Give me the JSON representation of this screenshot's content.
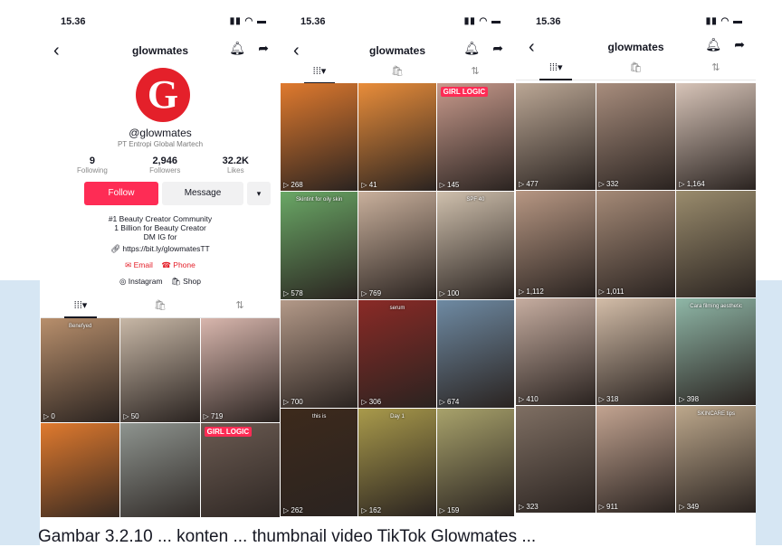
{
  "caption": "Gambar 3.2.10 ... konten ... thumbnail video TikTok Glowmates ...",
  "colors": {
    "accent": "#fe2c55",
    "brand_red": "#e4202a",
    "watermark": "#d6e6f3"
  },
  "status": {
    "time": "15.36",
    "icons": "signal-wifi-battery-icons"
  },
  "nav": {
    "back_icon": "back-chevron-icon",
    "title": "glowmates",
    "bell_icon": "bell-icon",
    "share_icon": "share-icon"
  },
  "profile": {
    "avatar_letter": "G",
    "username": "@glowmates",
    "subtitle": "PT Entropi Global Martech",
    "stats": [
      {
        "num": "9",
        "label": "Following"
      },
      {
        "num": "2,946",
        "label": "Followers"
      },
      {
        "num": "32.2K",
        "label": "Likes"
      }
    ],
    "follow_label": "Follow",
    "message_label": "Message",
    "more_label": "▾",
    "bio": [
      "#1 Beauty Creator Community",
      "1 Billion for Beauty Creator",
      "DM IG for"
    ],
    "link": "https://bit.ly/glowmatesTT",
    "email_label": "Email",
    "phone_label": "Phone",
    "instagram_label": "Instagram",
    "shop_label": "Shop"
  },
  "tabs": {
    "videos": "grid-icon",
    "shop": "shop-bag-icon",
    "reposts": "repost-icon",
    "videos_glyph": "⁞⁞⁞▾",
    "shop_glyph": "🛍",
    "reposts_glyph": "⇅"
  },
  "grid1": [
    {
      "views": "0",
      "caption": "Benefyed",
      "color": "#b88f6c"
    },
    {
      "views": "50",
      "caption": "",
      "color": "#c7b7a6"
    },
    {
      "views": "719",
      "caption": "",
      "color": "#d8b6ad"
    },
    {
      "views": "",
      "caption": "",
      "color": "#e07a2e"
    },
    {
      "views": "",
      "caption": "",
      "color": "#8e948f"
    },
    {
      "views": "",
      "caption": "",
      "color": "#6b5b52",
      "badge": "GIRL LOGIC"
    }
  ],
  "grid2": [
    {
      "views": "268",
      "caption": "",
      "color": "#e07a2e"
    },
    {
      "views": "41",
      "caption": "",
      "color": "#e98d3a"
    },
    {
      "views": "145",
      "caption": "",
      "color": "#c89a8c",
      "badge": "GIRL LOGIC"
    },
    {
      "views": "578",
      "caption": "Skintint for oily skin",
      "color": "#6aa866"
    },
    {
      "views": "769",
      "caption": "",
      "color": "#c9b09c"
    },
    {
      "views": "100",
      "caption": "SPF 40",
      "color": "#cfc0ad"
    },
    {
      "views": "700",
      "caption": "",
      "color": "#b39988"
    },
    {
      "views": "306",
      "caption": "serum",
      "color": "#8a2a26"
    },
    {
      "views": "674",
      "caption": "",
      "color": "#6e8aa3"
    },
    {
      "views": "262",
      "caption": "this is",
      "color": "#3d2a1c"
    },
    {
      "views": "162",
      "caption": "Day 1",
      "color": "#a99a4b"
    },
    {
      "views": "159",
      "caption": "",
      "color": "#a8a26b"
    }
  ],
  "grid3": [
    {
      "views": "477",
      "caption": "",
      "color": "#bba795"
    },
    {
      "views": "332",
      "caption": "",
      "color": "#a88d7d"
    },
    {
      "views": "1,164",
      "caption": "",
      "color": "#d7c4b8"
    },
    {
      "views": "1,112",
      "caption": "",
      "color": "#b79783"
    },
    {
      "views": "1,011",
      "caption": "",
      "color": "#a58a77"
    },
    {
      "views": "",
      "caption": "",
      "color": "#9a8c6d"
    },
    {
      "views": "410",
      "caption": "",
      "color": "#c6ada0"
    },
    {
      "views": "318",
      "caption": "",
      "color": "#d3bda8"
    },
    {
      "views": "398",
      "caption": "Cara filming aesthetic",
      "color": "#8fb7a7"
    },
    {
      "views": "323",
      "caption": "",
      "color": "#7f6f63"
    },
    {
      "views": "911",
      "caption": "",
      "color": "#c3a491"
    },
    {
      "views": "349",
      "caption": "SKINCARE tips",
      "color": "#bda88c"
    }
  ]
}
